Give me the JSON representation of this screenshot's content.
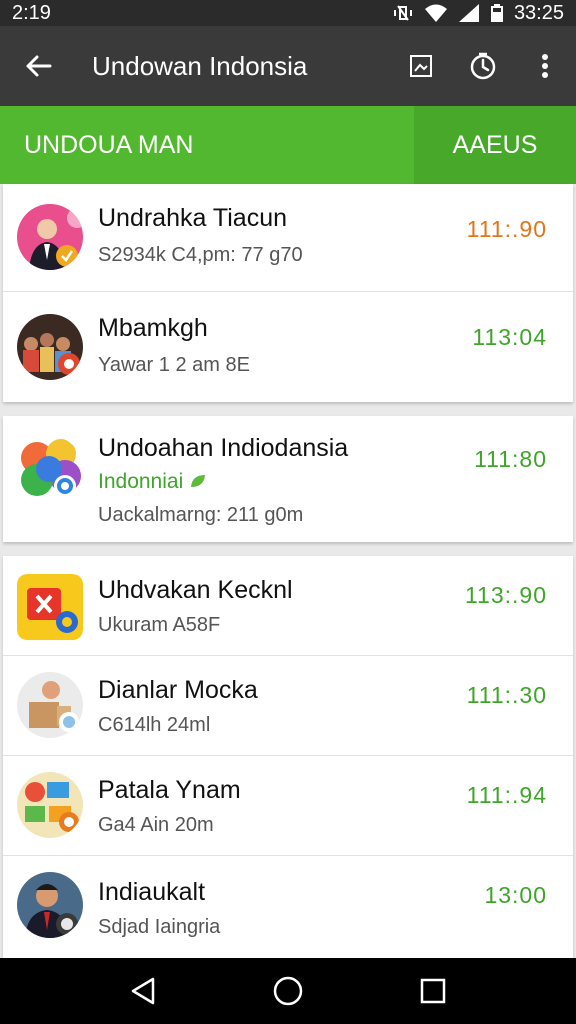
{
  "status_bar": {
    "time": "2:19",
    "clock": "33:25"
  },
  "app_bar": {
    "title": "Undowan Indonsia"
  },
  "tabs": {
    "main": "UNDOUA MAN",
    "alt": "AAEUS"
  },
  "contacts": [
    {
      "name": "Undrahka Tiacun",
      "detail": "S2934k C4,pm: 77 g70",
      "time": "111:.90"
    },
    {
      "name": "Mbamkgh",
      "detail": "Yawar 1 2 am 8E",
      "time": "113:04"
    },
    {
      "name": "Undoahan Indiodansia",
      "tag": "Indonniai",
      "detail": "Uackalmarng: 211 g0m",
      "time": "111:80"
    },
    {
      "name": "Uhdvakan Kecknl",
      "detail": "Ukuram A58F",
      "time": "113:.90"
    },
    {
      "name": "Dianlar Mocka",
      "detail": "C614lh 24ml",
      "time": "111:.30"
    },
    {
      "name": "Patala Ynam",
      "detail": "Ga4 Ain 20m",
      "time": "111:.94"
    },
    {
      "name": "Indiaukalt",
      "detail": "Sdjad Iaingria",
      "time": "13:00"
    }
  ],
  "colors": {
    "accent": "#52b82f",
    "time_green": "#3fa52a",
    "time_orange": "#e0761a",
    "app_bar": "#3a3a3a"
  }
}
